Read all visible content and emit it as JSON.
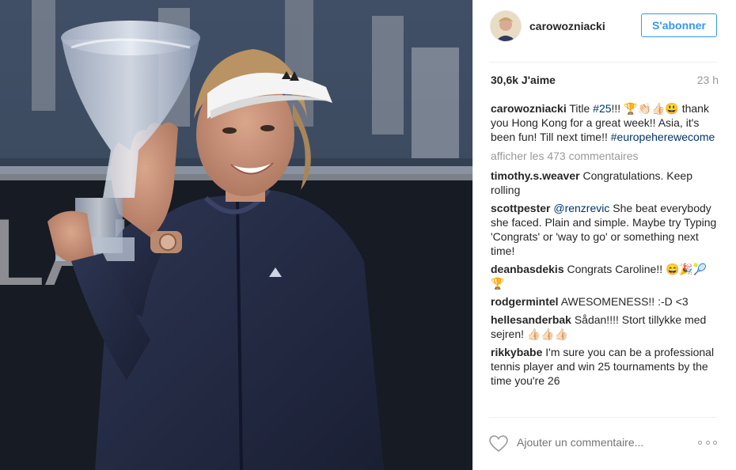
{
  "header": {
    "username": "carowozniacki",
    "follow_label": "S'abonner"
  },
  "stats": {
    "likes": "30,6k J'aime",
    "time": "23 h"
  },
  "caption": {
    "user": "carowozniacki",
    "text_before": " Title ",
    "hashtag1": "#25",
    "text_after": "!!! 🏆👏🏻👍🏻😃 thank you Hong Kong for a great week!! Asia, it's been fun! Till next time!! ",
    "hashtag2": "#europeherewecome"
  },
  "more_comments": "afficher les 473 commentaires",
  "comments": [
    {
      "user": "timothy.s.weaver",
      "text": " Congratulations. Keep rolling"
    },
    {
      "user": "scottpester",
      "mention": "@renzrevic",
      "text": " She beat everybody she faced. Plain and simple. Maybe try Typing 'Congrats' or 'way to go' or something next time!"
    },
    {
      "user": "deanbasdekis",
      "text": " Congrats Caroline!! 😄🎉🎾🏆"
    },
    {
      "user": "rodgermintel",
      "text": " AWESOMENESS!! :-D <3"
    },
    {
      "user": "hellesanderbak",
      "text": " Sådan!!!! Stort tillykke med sejren! 👍🏻👍🏻👍🏻"
    },
    {
      "user": "rikkybabe",
      "text": " I'm sure you can be a professional tennis player and win 25 tournaments by the time you're 26"
    }
  ],
  "comment_box": {
    "placeholder": "Ajouter un commentaire..."
  },
  "icons": {
    "like": "heart-icon",
    "options": "more-options-icon"
  },
  "colors": {
    "accent": "#3897f0",
    "link": "#003569",
    "muted": "#999999",
    "text": "#262626"
  }
}
